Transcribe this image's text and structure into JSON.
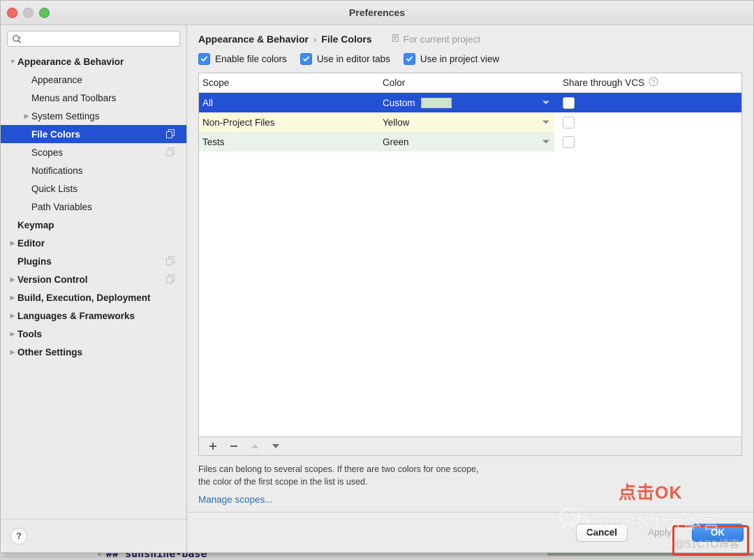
{
  "window": {
    "title": "Preferences",
    "traffic_lights": [
      "close-red",
      "minimize-disabled",
      "zoom-green"
    ]
  },
  "sidebar": {
    "search": {
      "value": "",
      "placeholder": ""
    },
    "items": [
      {
        "label": "Appearance & Behavior",
        "level": 1,
        "bold": true,
        "twisty": "down",
        "selected": false,
        "project_icon": false
      },
      {
        "label": "Appearance",
        "level": 2,
        "bold": false,
        "twisty": "none",
        "selected": false,
        "project_icon": false
      },
      {
        "label": "Menus and Toolbars",
        "level": 2,
        "bold": false,
        "twisty": "none",
        "selected": false,
        "project_icon": false
      },
      {
        "label": "System Settings",
        "level": 2,
        "bold": false,
        "twisty": "right",
        "selected": false,
        "project_icon": false
      },
      {
        "label": "File Colors",
        "level": 2,
        "bold": true,
        "twisty": "none",
        "selected": true,
        "project_icon": true
      },
      {
        "label": "Scopes",
        "level": 2,
        "bold": false,
        "twisty": "none",
        "selected": false,
        "project_icon": true
      },
      {
        "label": "Notifications",
        "level": 2,
        "bold": false,
        "twisty": "none",
        "selected": false,
        "project_icon": false
      },
      {
        "label": "Quick Lists",
        "level": 2,
        "bold": false,
        "twisty": "none",
        "selected": false,
        "project_icon": false
      },
      {
        "label": "Path Variables",
        "level": 2,
        "bold": false,
        "twisty": "none",
        "selected": false,
        "project_icon": false
      },
      {
        "label": "Keymap",
        "level": 1,
        "bold": true,
        "twisty": "none",
        "selected": false,
        "project_icon": false
      },
      {
        "label": "Editor",
        "level": 1,
        "bold": true,
        "twisty": "right",
        "selected": false,
        "project_icon": false
      },
      {
        "label": "Plugins",
        "level": 1,
        "bold": true,
        "twisty": "none",
        "selected": false,
        "project_icon": true
      },
      {
        "label": "Version Control",
        "level": 1,
        "bold": true,
        "twisty": "right",
        "selected": false,
        "project_icon": true
      },
      {
        "label": "Build, Execution, Deployment",
        "level": 1,
        "bold": true,
        "twisty": "right",
        "selected": false,
        "project_icon": false
      },
      {
        "label": "Languages & Frameworks",
        "level": 1,
        "bold": true,
        "twisty": "right",
        "selected": false,
        "project_icon": false
      },
      {
        "label": "Tools",
        "level": 1,
        "bold": true,
        "twisty": "right",
        "selected": false,
        "project_icon": false
      },
      {
        "label": "Other Settings",
        "level": 1,
        "bold": true,
        "twisty": "right",
        "selected": false,
        "project_icon": false
      }
    ],
    "help_label": "?"
  },
  "main": {
    "breadcrumb": {
      "root": "Appearance & Behavior",
      "separator": "›",
      "leaf": "File Colors"
    },
    "for_current_project": "For current project",
    "checkboxes": [
      {
        "label": "Enable file colors",
        "checked": true
      },
      {
        "label": "Use in editor tabs",
        "checked": true
      },
      {
        "label": "Use in project view",
        "checked": true
      }
    ],
    "table": {
      "columns": [
        "Scope",
        "Color",
        "Share through VCS"
      ],
      "vcs_help": "?",
      "rows": [
        {
          "scope": "All",
          "color": "Custom",
          "swatch": "#cfe3cf",
          "row_bg": "#2351d4",
          "selected": true,
          "vcs_checked": false
        },
        {
          "scope": "Non-Project Files",
          "color": "Yellow",
          "swatch": "",
          "row_bg": "#fbfade",
          "selected": false,
          "vcs_checked": false
        },
        {
          "scope": "Tests",
          "color": "Green",
          "swatch": "",
          "row_bg": "#e9f3e9",
          "selected": false,
          "vcs_checked": false
        }
      ]
    },
    "toolbar": {
      "add": "+",
      "remove": "−",
      "move_up": "move-up",
      "move_down": "move-down"
    },
    "hint": "Files can belong to several scopes. If there are two colors for one scope, the color of the first scope in the list is used.",
    "manage_scopes": "Manage scopes..."
  },
  "footer": {
    "cancel": "Cancel",
    "apply": "Apply",
    "ok": "OK"
  },
  "annotations": {
    "click_ok": "点击OK"
  },
  "watermark": {
    "brand": "java技术大本营",
    "source": "@51CTO博客"
  },
  "backdrop": {
    "code_line": "## sunshine-base"
  },
  "colors": {
    "accent": "#2351d4",
    "primary_button": "#3b8bf0",
    "annotation_red": "#e8402a",
    "link": "#2f6fae"
  }
}
